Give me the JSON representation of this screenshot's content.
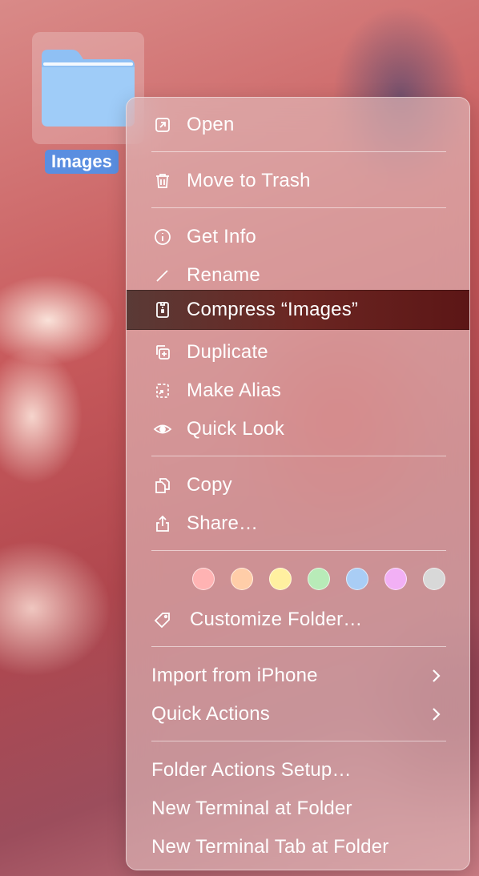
{
  "desktop": {
    "folder": {
      "label": "Images",
      "icon": "folder-icon"
    }
  },
  "context_menu": {
    "items": [
      {
        "label": "Open",
        "icon": "open-icon"
      },
      {
        "label": "Move to Trash",
        "icon": "trash-icon"
      },
      {
        "label": "Get Info",
        "icon": "info-icon"
      },
      {
        "label": "Rename",
        "icon": "pencil-icon"
      },
      {
        "label": "Compress “Images”",
        "icon": "zip-icon",
        "highlighted": true
      },
      {
        "label": "Duplicate",
        "icon": "duplicate-icon"
      },
      {
        "label": "Make Alias",
        "icon": "alias-icon"
      },
      {
        "label": "Quick Look",
        "icon": "eye-icon"
      },
      {
        "label": "Copy",
        "icon": "copy-icon"
      },
      {
        "label": "Share…",
        "icon": "share-icon"
      },
      {
        "label": "Customize Folder…",
        "icon": "tag-icon"
      },
      {
        "label": "Import from iPhone",
        "submenu": true
      },
      {
        "label": "Quick Actions",
        "submenu": true
      },
      {
        "label": "Folder Actions Setup…"
      },
      {
        "label": "New Terminal at Folder"
      },
      {
        "label": "New Terminal Tab at Folder"
      }
    ],
    "tag_colors": [
      "#ffb3b3",
      "#ffcda8",
      "#fff0a0",
      "#b8ebb8",
      "#a9cdf5",
      "#f2b0f5",
      "#d8d8d8"
    ],
    "highlight_color": "#6b2622"
  }
}
